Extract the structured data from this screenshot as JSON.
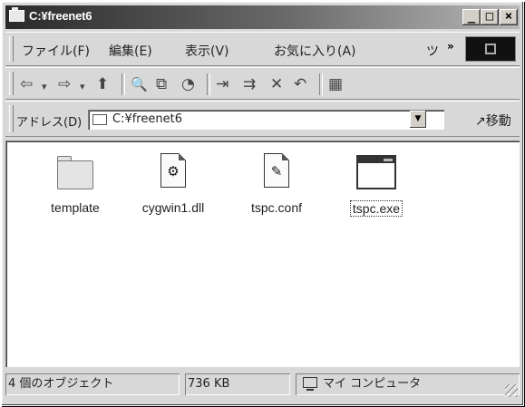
{
  "window": {
    "title": "C:¥freenet6",
    "controls": {
      "minimize": "_",
      "maximize": "□",
      "close": "×"
    }
  },
  "menubar": {
    "items": [
      "ファイル(F)",
      "編集(E)",
      "表示(V)",
      "お気に入り(A)",
      "ツ"
    ],
    "overflow": "»"
  },
  "toolbar": {
    "buttons": [
      {
        "icon": "back-icon",
        "glyph": "⇦"
      },
      {
        "icon": "dropdown-icon",
        "glyph": "▾"
      },
      {
        "icon": "forward-icon",
        "glyph": "⇨"
      },
      {
        "icon": "dropdown-icon",
        "glyph": "▾"
      },
      {
        "icon": "up-folder-icon",
        "glyph": "⬆"
      },
      {
        "icon": "search-icon",
        "glyph": "🔍"
      },
      {
        "icon": "folders-icon",
        "glyph": "⧉"
      },
      {
        "icon": "history-icon",
        "glyph": "◔"
      },
      {
        "icon": "move-to-icon",
        "glyph": "⇥"
      },
      {
        "icon": "copy-to-icon",
        "glyph": "⇉"
      },
      {
        "icon": "delete-icon",
        "glyph": "✕"
      },
      {
        "icon": "undo-icon",
        "glyph": "↶"
      },
      {
        "icon": "views-icon",
        "glyph": "▦"
      }
    ]
  },
  "addressbar": {
    "label": "アドレス(D)",
    "value": "C:¥freenet6",
    "go_label": "↗移動"
  },
  "files": [
    {
      "name": "template",
      "type": "folder",
      "selected": false
    },
    {
      "name": "cygwin1.dll",
      "type": "dll",
      "selected": false
    },
    {
      "name": "tspc.conf",
      "type": "conf",
      "selected": false
    },
    {
      "name": "tspc.exe",
      "type": "exe",
      "selected": true
    }
  ],
  "statusbar": {
    "object_count": "4 個のオブジェクト",
    "size": "736 KB",
    "zone": "マイ コンピュータ"
  }
}
